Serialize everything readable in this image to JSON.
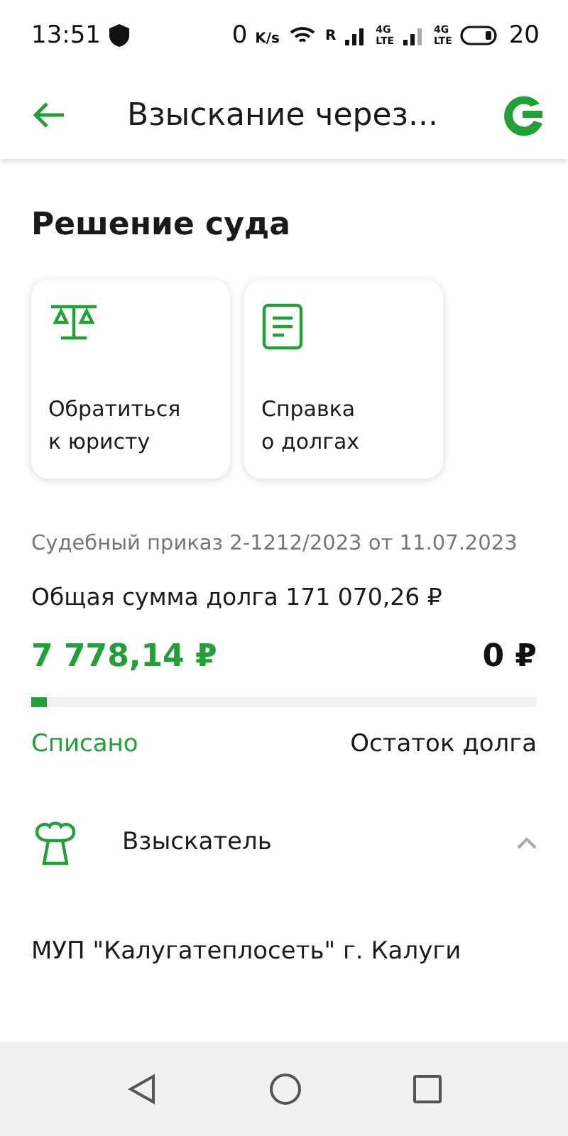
{
  "status_bar": {
    "time": "13:51",
    "speed": "0",
    "speed_unit": "K/s",
    "roaming": "R",
    "network_1": "4G",
    "network_1_sub": "LTE",
    "network_2": "4G",
    "network_2_sub": "LTE",
    "battery": "20"
  },
  "header": {
    "title": "Взыскание через..."
  },
  "section_title": "Решение суда",
  "actions": [
    {
      "kind": "scales",
      "label": "Обратиться\nк юристу"
    },
    {
      "kind": "document",
      "label": "Справка\nо долгах"
    }
  ],
  "case": "Судебный приказ 2-1212/2023 от 11.07.2023",
  "total": "Общая сумма долга 171 070,26 ₽",
  "paid": {
    "amount": "7 778,14 ₽",
    "label": "Списано"
  },
  "remaining": {
    "amount": "0 ₽",
    "label": "Остаток долга"
  },
  "progress": {
    "level": 0.03
  },
  "collector": {
    "title": "Взыскатель",
    "expanded": true,
    "name": "МУП \"Калугатеплосеть\" г. Калуги"
  }
}
